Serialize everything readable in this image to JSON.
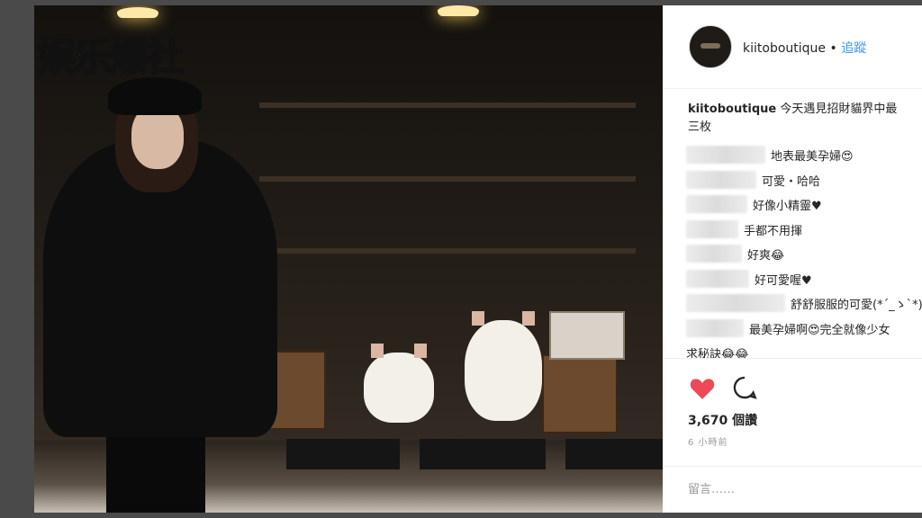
{
  "watermark": "娱乐爆社",
  "header": {
    "username": "kiitoboutique",
    "separator": "•",
    "follow_label": "追蹤"
  },
  "caption": {
    "user": "kiitoboutique",
    "text": "今天遇見招財貓界中最",
    "text_line2": "三枚"
  },
  "comments": [
    {
      "blur_width": 88,
      "text": "地表最美孕婦😍"
    },
    {
      "blur_width": 78,
      "text": "可愛・哈哈"
    },
    {
      "blur_width": 68,
      "text": "好像小精靈♥"
    },
    {
      "blur_width": 58,
      "text": "手都不用揮"
    },
    {
      "blur_width": 62,
      "text": "好爽😂"
    },
    {
      "blur_width": 70,
      "text": "好可愛喔♥"
    },
    {
      "blur_width": 110,
      "text": "舒舒服服的可愛(*´_ゝ`*)"
    },
    {
      "blur_width": 64,
      "text": "最美孕婦啊😍完全就像少女"
    },
    {
      "blur_width": 0,
      "text": "求秘訣😂😂"
    }
  ],
  "actions": {
    "likes_count": "3,670",
    "likes_label": "個讚",
    "timestamp": "6 小時前",
    "heart_color": "#ed4956"
  },
  "add_comment": {
    "placeholder": "留言……"
  }
}
